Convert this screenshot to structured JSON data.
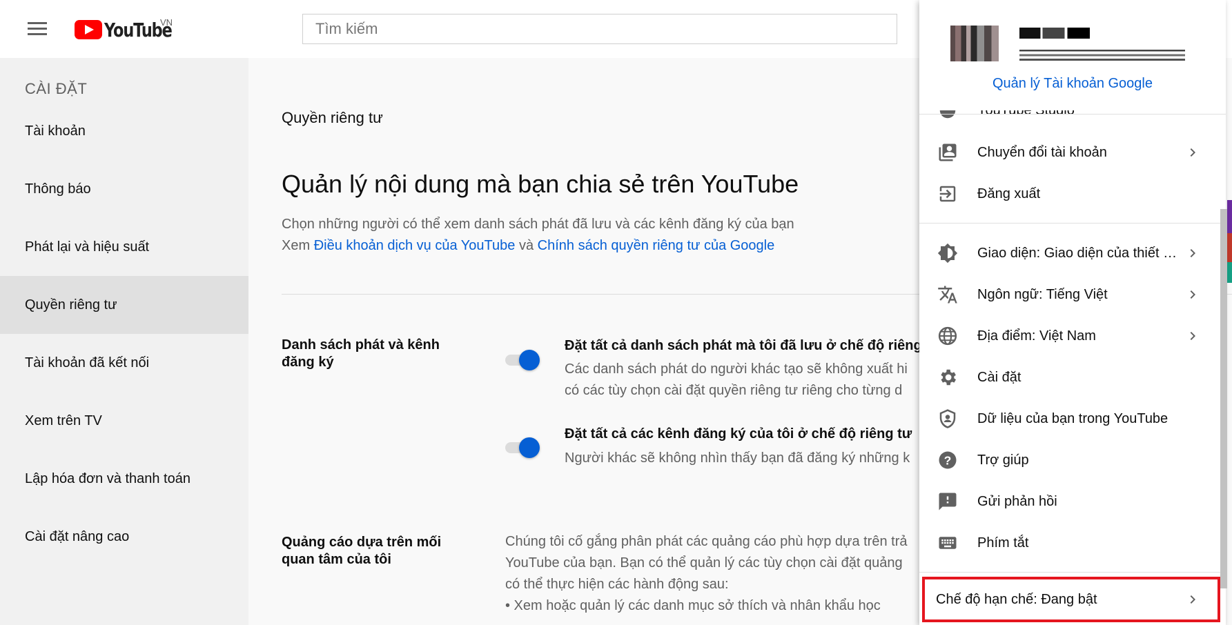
{
  "header": {
    "logo_text": "YouTube",
    "country_code": "VN",
    "search_placeholder": "Tìm kiếm"
  },
  "sidebar": {
    "heading": "CÀI ĐẶT",
    "items": [
      {
        "label": "Tài khoản"
      },
      {
        "label": "Thông báo"
      },
      {
        "label": "Phát lại và hiệu suất"
      },
      {
        "label": "Quyền riêng tư"
      },
      {
        "label": "Tài khoản đã kết nối"
      },
      {
        "label": "Xem trên TV"
      },
      {
        "label": "Lập hóa đơn và thanh toán"
      },
      {
        "label": "Cài đặt nâng cao"
      }
    ],
    "active": "Quyền riêng tư"
  },
  "main": {
    "section_label": "Quyền riêng tư",
    "headline": "Quản lý nội dung mà bạn chia sẻ trên YouTube",
    "desc_line1": "Chọn những người có thể xem danh sách phát đã lưu và các kênh đăng ký của bạn",
    "desc_prefix": "Xem ",
    "link_tos": "Điều khoản dịch vụ của YouTube",
    "desc_and": " và ",
    "link_privacy": "Chính sách quyền riêng tư của Google",
    "playlists_label": "Danh sách phát và kênh đăng ký",
    "opt1_title": "Đặt tất cả danh sách phát mà tôi đã lưu ở chế độ riêng",
    "opt1_desc1": "Các danh sách phát do người khác tạo sẽ không xuất hi",
    "opt1_desc2": "có các tùy chọn cài đặt quyền riêng tư riêng cho từng d",
    "opt2_title": "Đặt tất cả các kênh đăng ký của tôi ở chế độ riêng tư",
    "opt2_desc": "Người khác sẽ không nhìn thấy bạn đã đăng ký những k",
    "ads_label": "Quảng cáo dựa trên mối quan tâm của tôi",
    "ads_desc1": "Chúng tôi cố gắng phân phát các quảng cáo phù hợp dựa trên trả",
    "ads_desc2": "YouTube của bạn. Bạn có thể quản lý các tùy chọn cài đặt quảng",
    "ads_desc3": "có thể thực hiện các hành động sau:",
    "ads_bullet1": "• Xem hoặc quản lý các danh mục sở thích và nhân khẩu học",
    "toggle_states": {
      "saved_playlists_private": true,
      "subscriptions_private": true
    }
  },
  "account_menu": {
    "manage_link": "Quản lý Tài khoản Google",
    "partial_item": "YouTube Studio",
    "items": {
      "switch_account": "Chuyển đổi tài khoản",
      "sign_out": "Đăng xuất",
      "appearance": "Giao diện: Giao diện của thiết …",
      "language": "Ngôn ngữ: Tiếng Việt",
      "location": "Địa điểm: Việt Nam",
      "settings": "Cài đặt",
      "your_data": "Dữ liệu của bạn trong YouTube",
      "help": "Trợ giúp",
      "feedback": "Gửi phản hồi",
      "shortcuts": "Phím tắt",
      "restricted": "Chế độ hạn chế: Đang bật"
    }
  },
  "colors": {
    "brand_red": "#ff0000",
    "link_blue": "#065fd4",
    "highlight_red": "#e5161f"
  }
}
